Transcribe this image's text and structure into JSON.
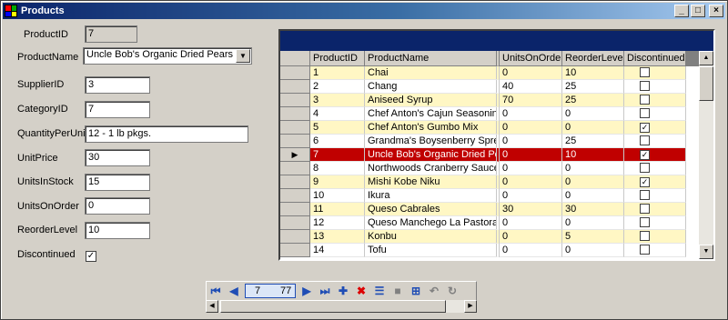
{
  "window": {
    "title": "Products",
    "buttons": {
      "minimize": "_",
      "maximize": "□",
      "close": "×"
    }
  },
  "form": {
    "product_id": {
      "label": "ProductID",
      "value": "7"
    },
    "product_name": {
      "label": "ProductName",
      "value": "Uncle Bob's Organic Dried Pears"
    },
    "supplier_id": {
      "label": "SupplierID",
      "value": "3"
    },
    "category_id": {
      "label": "CategoryID",
      "value": "7"
    },
    "quantity_per_unit": {
      "label": "QuantityPerUnit",
      "value": "12 - 1 lb pkgs."
    },
    "unit_price": {
      "label": "UnitPrice",
      "value": "30"
    },
    "units_in_stock": {
      "label": "UnitsInStock",
      "value": "15"
    },
    "units_on_order": {
      "label": "UnitsOnOrder",
      "value": "0"
    },
    "reorder_level": {
      "label": "ReorderLevel",
      "value": "10"
    },
    "discontinued": {
      "label": "Discontinued",
      "checked": true
    }
  },
  "grid": {
    "headers": [
      "ProductID",
      "ProductName",
      "UnitsOnOrder",
      "ReorderLevel",
      "Discontinued"
    ],
    "rows": [
      {
        "id": "1",
        "name": "Chai",
        "on_order": "0",
        "reorder": "10",
        "disc": false
      },
      {
        "id": "2",
        "name": "Chang",
        "on_order": "40",
        "reorder": "25",
        "disc": false
      },
      {
        "id": "3",
        "name": "Aniseed Syrup",
        "on_order": "70",
        "reorder": "25",
        "disc": false
      },
      {
        "id": "4",
        "name": "Chef Anton's Cajun Seasoning",
        "on_order": "0",
        "reorder": "0",
        "disc": false
      },
      {
        "id": "5",
        "name": "Chef Anton's Gumbo Mix",
        "on_order": "0",
        "reorder": "0",
        "disc": true
      },
      {
        "id": "6",
        "name": "Grandma's Boysenberry Spre",
        "on_order": "0",
        "reorder": "25",
        "disc": false
      },
      {
        "id": "7",
        "name": "Uncle Bob's Organic Dried Pe",
        "on_order": "0",
        "reorder": "10",
        "disc": true,
        "selected": true
      },
      {
        "id": "8",
        "name": "Northwoods Cranberry Sauce",
        "on_order": "0",
        "reorder": "0",
        "disc": false
      },
      {
        "id": "9",
        "name": "Mishi Kobe Niku",
        "on_order": "0",
        "reorder": "0",
        "disc": true
      },
      {
        "id": "10",
        "name": "Ikura",
        "on_order": "0",
        "reorder": "0",
        "disc": false
      },
      {
        "id": "11",
        "name": "Queso Cabrales",
        "on_order": "30",
        "reorder": "30",
        "disc": false
      },
      {
        "id": "12",
        "name": "Queso Manchego La Pastora",
        "on_order": "0",
        "reorder": "0",
        "disc": false
      },
      {
        "id": "13",
        "name": "Konbu",
        "on_order": "0",
        "reorder": "5",
        "disc": false
      },
      {
        "id": "14",
        "name": "Tofu",
        "on_order": "0",
        "reorder": "0",
        "disc": false
      }
    ]
  },
  "navigator": {
    "position": "7",
    "count": "77"
  },
  "colors": {
    "selected_row": "#c00000",
    "alt_row": "#fff7c4",
    "caption": "#0a246a"
  }
}
